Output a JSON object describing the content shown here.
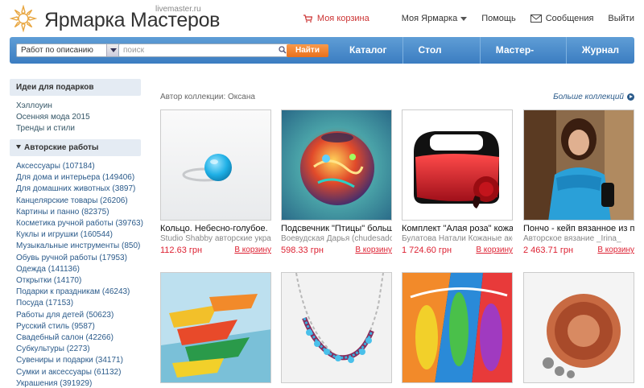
{
  "header": {
    "brand": "Ярмарка Мастеров",
    "domain": "livemaster.ru",
    "cart": "Моя корзина",
    "my_fair": "Моя Ярмарка",
    "help": "Помощь",
    "messages": "Сообщения",
    "logout": "Выйти"
  },
  "searchbar": {
    "select_value": "Работ по описанию",
    "placeholder": "поиск",
    "find_button": "Найти"
  },
  "mainnav": [
    "Каталог",
    "Стол заказов",
    "Мастер-Классы",
    "Журнал"
  ],
  "sidebar": {
    "gifts_heading": "Идеи для подарков",
    "gift_links": [
      "Хэллоуин",
      "Осенняя мода 2015",
      "Тренды и стили"
    ],
    "works_heading": "Авторские работы",
    "categories": [
      "Аксессуары (107184)",
      "Для дома и интерьера (149406)",
      "Для домашних животных (3897)",
      "Канцелярские товары (26206)",
      "Картины и панно (82375)",
      "Косметика ручной работы (39763)",
      "Куклы и игрушки (160544)",
      "Музыкальные инструменты (850)",
      "Обувь ручной работы (17953)",
      "Одежда (141136)",
      "Открытки (14170)",
      "Подарки к праздникам (46243)",
      "Посуда (17153)",
      "Работы для детей (50623)",
      "Русский стиль (9587)",
      "Свадебный салон (42266)",
      "Субкультуры (2273)",
      "Сувениры и подарки (34171)",
      "Сумки и аксессуары (61132)",
      "Украшения (391929)"
    ]
  },
  "collection": {
    "author": "Автор коллекции: Оксана",
    "more": "Больше коллекций"
  },
  "products": [
    {
      "title": "Кольцо. Небесно-голубое.",
      "seller": "Studio Shabby авторские украшения",
      "price": "112.63 грн",
      "buy": "В корзину"
    },
    {
      "title": "Подсвечник \"Птицы\" большой",
      "seller": "Воевудская Дарья (chudesador)",
      "price": "598.33 грн",
      "buy": "В корзину"
    },
    {
      "title": "Комплект \"Алая роза\" кожа",
      "seller": "Булатова Натали Кожаные аксессуары",
      "price": "1 724.60 грн",
      "buy": "В корзину"
    },
    {
      "title": "Пончо - кейп вязанное из пряжи",
      "seller": "Авторское вязание _Irina_",
      "price": "2 463.71 грн",
      "buy": "В корзину"
    }
  ]
}
